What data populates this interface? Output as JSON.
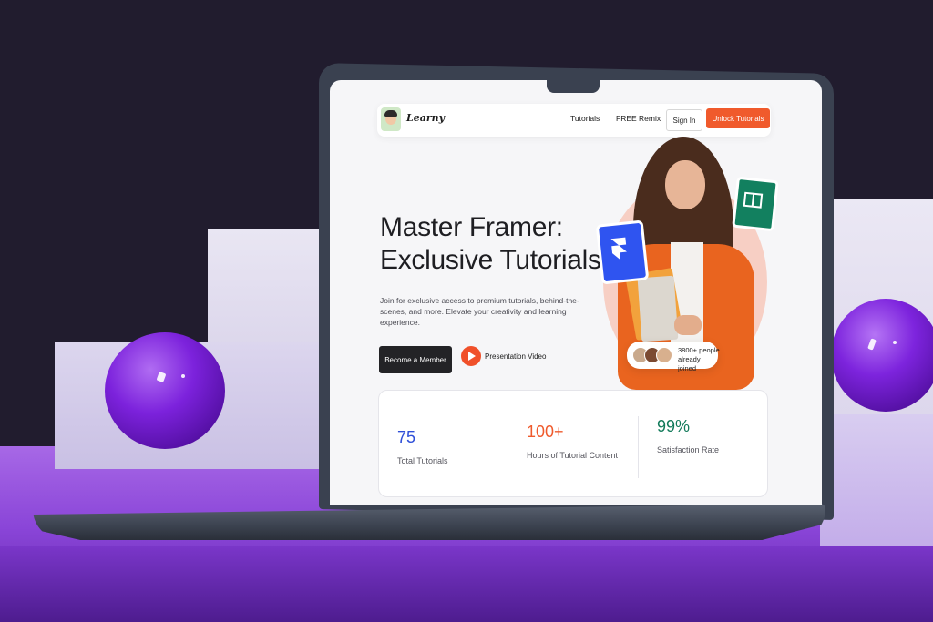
{
  "site": {
    "logo_text": "Learny"
  },
  "nav": {
    "links": [
      "Tutorials",
      "FREE Remix"
    ],
    "signin_label": "Sign In",
    "cta_label": "Unlock Tutorials"
  },
  "hero": {
    "title_line1": "Master Framer:",
    "title_line2": "Exclusive Tutorials",
    "subtitle": "Join for exclusive access to premium tutorials, behind-the-scenes, and more. Elevate your creativity and learning experience.",
    "primary_button": "Become a Member",
    "video_link": "Presentation Video",
    "social_proof": "3800+ people already joined"
  },
  "stats": [
    {
      "value": "75",
      "label": "Total Tutorials",
      "color": "#2f4fd8"
    },
    {
      "value": "100+",
      "label": "Hours of Tutorial Content",
      "color": "#ef5a2c"
    },
    {
      "value": "99%",
      "label": "Satisfaction Rate",
      "color": "#127a5a"
    }
  ],
  "colors": {
    "accent": "#f05a2c",
    "framer_badge": "#2f54f0",
    "book_badge": "#12805f"
  },
  "icons": [
    "framer-icon",
    "book-icon",
    "play-icon",
    "logo-avatar-icon"
  ]
}
